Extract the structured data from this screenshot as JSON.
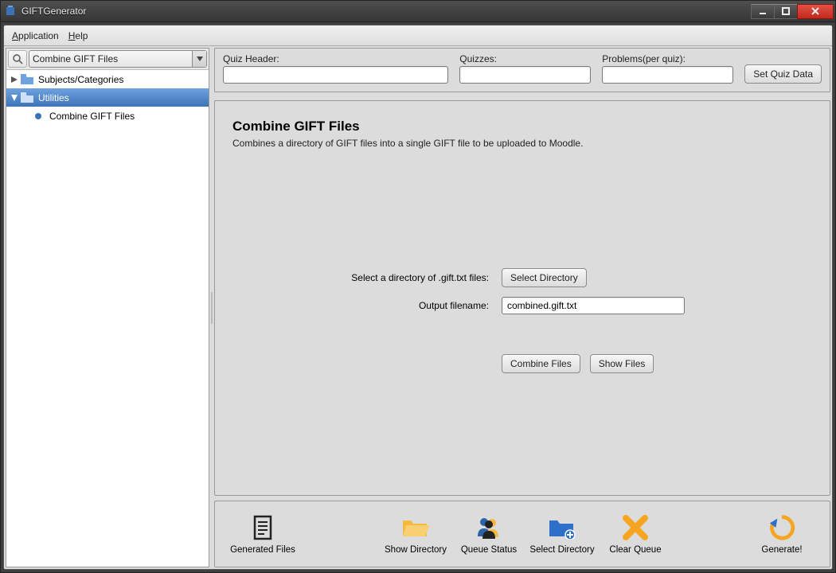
{
  "title": "GIFTGenerator",
  "menubar": {
    "application": "Application",
    "help": "Help"
  },
  "sidebar": {
    "combo": "Combine GIFT Files",
    "items": [
      {
        "label": "Subjects/Categories"
      },
      {
        "label": "Utilities"
      },
      {
        "label": "Combine GIFT Files"
      }
    ]
  },
  "topstrip": {
    "quiz_header_label": "Quiz Header:",
    "quizzes_label": "Quizzes:",
    "problems_label": "Problems(per quiz):",
    "set_quiz": "Set Quiz Data",
    "quiz_header_value": "",
    "quizzes_value": "",
    "problems_value": ""
  },
  "content": {
    "title": "Combine GIFT Files",
    "desc": "Combines a directory of GIFT files into a single GIFT file to be uploaded to Moodle.",
    "select_dir_label": "Select a directory of .gift.txt files:",
    "select_dir_btn": "Select Directory",
    "output_label": "Output filename:",
    "output_value": "combined.gift.txt",
    "combine_btn": "Combine Files",
    "show_btn": "Show Files"
  },
  "bottombar": {
    "generated": "Generated Files",
    "show_dir": "Show Directory",
    "queue_status": "Queue Status",
    "select_dir": "Select Directory",
    "clear_queue": "Clear Queue",
    "generate": "Generate!"
  }
}
